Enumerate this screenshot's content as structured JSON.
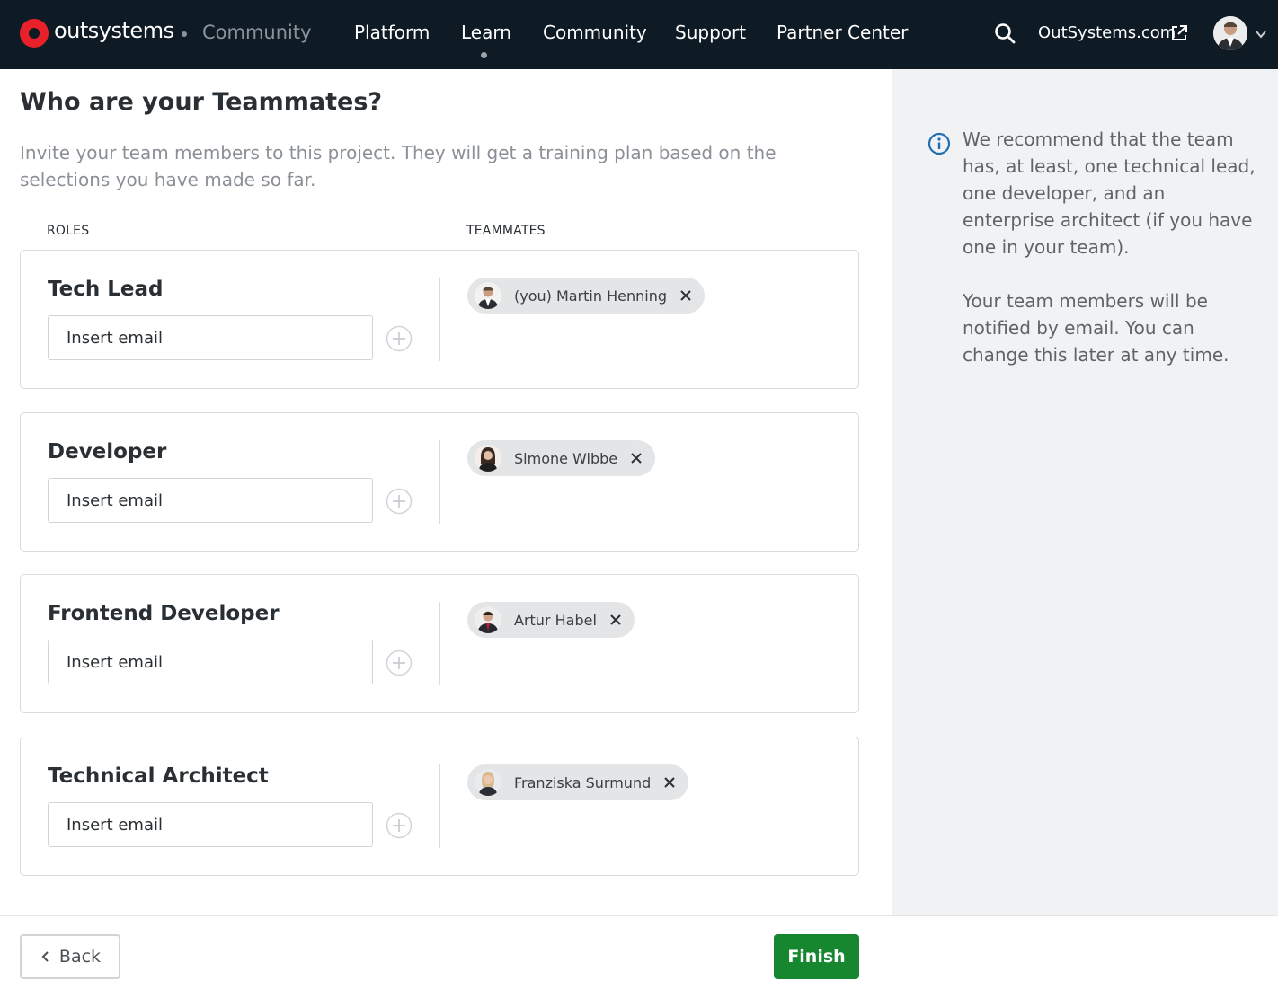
{
  "nav": {
    "brand": "outsystems",
    "brand_sub": "Community",
    "items": [
      "Platform",
      "Learn",
      "Community",
      "Support",
      "Partner Center"
    ],
    "active_item": "Learn",
    "external_link": "OutSystems.com"
  },
  "page": {
    "title": "Who are your Teammates?",
    "description": "Invite your team members to this project. They will get a training plan based on the selections you have made so far."
  },
  "columns": {
    "roles": "ROLES",
    "teammates": "TEAMMATES"
  },
  "roles": [
    {
      "title": "Tech Lead",
      "placeholder": "Insert email",
      "teammate": "(you) Martin Henning"
    },
    {
      "title": "Developer",
      "placeholder": "Insert email",
      "teammate": "Simone Wibbe"
    },
    {
      "title": "Frontend Developer",
      "placeholder": "Insert email",
      "teammate": "Artur Habel"
    },
    {
      "title": "Technical Architect",
      "placeholder": "Insert email",
      "teammate": "Franziska Surmund"
    }
  ],
  "side": {
    "recommendation": "We recommend that the team has, at least, one technical lead, one developer, and an enterprise architect (if you have one in your team).",
    "notice": "Your team members will be notified by email. You can change this later at any time."
  },
  "footer": {
    "back_label": "Back",
    "finish_label": "Finish"
  },
  "colors": {
    "nav_bg": "#0e1a24",
    "brand_red": "#e8202a",
    "finish_green": "#16872f",
    "info_blue": "#1f6fb5"
  }
}
